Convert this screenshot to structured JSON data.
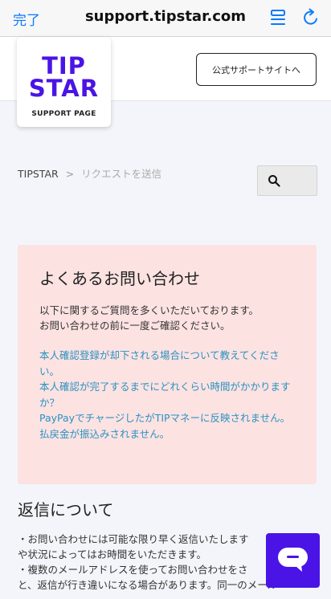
{
  "browser": {
    "done_label": "完了",
    "url": "support.tipstar.com",
    "icons": [
      "reader-icon",
      "reload-icon"
    ]
  },
  "header": {
    "logo_line1": "TIP",
    "logo_line2": "STAR",
    "logo_sub": "SUPPORT PAGE",
    "official_button": "公式サポートサイトへ"
  },
  "breadcrumb": {
    "home": "TIPSTAR",
    "separator": ">",
    "current": "リクエストを送信"
  },
  "search": {
    "icon": "search-icon"
  },
  "faq": {
    "title": "よくあるお問い合わせ",
    "intro_line1": "以下に関するご質問を多くいただいております。",
    "intro_line2": "お問い合わせの前に一度ご確認ください。",
    "links": [
      "本人確認登録が却下される場合について教えてください。",
      "本人確認が完了するまでにどれくらい時間がかかりますか？",
      "PayPayでチャージしたがTIPマネーに反映されません。",
      "払戻金が振込みされません。"
    ]
  },
  "reply": {
    "title": "返信について",
    "line1": "・お問い合わせには可能な限り早く返信いたします",
    "line2": "や状況によってはお時間をいただきます。",
    "line3": "・複数のメールアドレスを使ってお問い合わせをさ",
    "line4": "と、返信が行き違いになる場合があります。同一のメール"
  },
  "colors": {
    "brand": "#4a14e6",
    "link": "#2a92c0",
    "faq_background": "#fde2e2",
    "safari_blue": "#0a7aff"
  }
}
